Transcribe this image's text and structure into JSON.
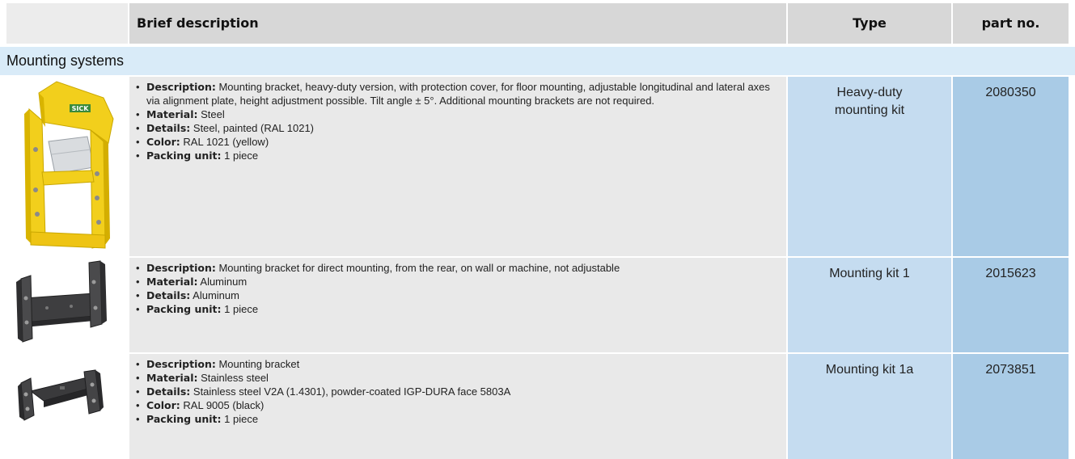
{
  "header": {
    "col_description": "Brief description",
    "col_type": "Type",
    "col_part_no": "part no."
  },
  "section": {
    "title": "Mounting systems"
  },
  "rows": [
    {
      "image": "heavy-duty-yellow-bracket",
      "props": [
        {
          "key": "Description:",
          "value": " Mounting bracket, heavy-duty version, with protection cover, for floor mounting, adjustable longitudinal and lateral axes via alignment plate, height adjustment possible. Tilt angle ± 5°. Additional mounting brackets are not required."
        },
        {
          "key": "Material:",
          "value": " Steel"
        },
        {
          "key": "Details:",
          "value": " Steel, painted (RAL 1021)"
        },
        {
          "key": "Color:",
          "value": " RAL 1021 (yellow)"
        },
        {
          "key": "Packing unit:",
          "value": " 1 piece"
        }
      ],
      "type_line1": "Heavy-duty",
      "type_line2": "mounting kit",
      "part_no": "2080350",
      "logo_text": "SICK"
    },
    {
      "image": "aluminum-wall-bracket",
      "props": [
        {
          "key": "Description:",
          "value": " Mounting bracket for direct mounting, from the rear, on wall or machine, not adjustable"
        },
        {
          "key": "Material:",
          "value": " Aluminum"
        },
        {
          "key": "Details:",
          "value": " Aluminum"
        },
        {
          "key": "Packing unit:",
          "value": " 1 piece"
        }
      ],
      "type_line1": "Mounting kit 1",
      "part_no": "2015623"
    },
    {
      "image": "stainless-steel-bracket",
      "props": [
        {
          "key": "Description:",
          "value": " Mounting bracket"
        },
        {
          "key": "Material:",
          "value": " Stainless steel"
        },
        {
          "key": "Details:",
          "value": " Stainless steel V2A (1.4301), powder-coated IGP-DURA face 5803A"
        },
        {
          "key": "Color:",
          "value": " RAL 9005 (black)"
        },
        {
          "key": "Packing unit:",
          "value": " 1 piece"
        }
      ],
      "type_line1": "Mounting kit 1a",
      "part_no": "2073851"
    }
  ],
  "colors": {
    "header_bg": "#d7d7d7",
    "section_bg": "#d9ebf8",
    "desc_bg": "#e9e9e9",
    "type_bg": "#c5dcf0",
    "part_bg": "#a9cbe6",
    "bracket_yellow": "#f2cf1c",
    "logo_green": "#3a8a3a"
  }
}
